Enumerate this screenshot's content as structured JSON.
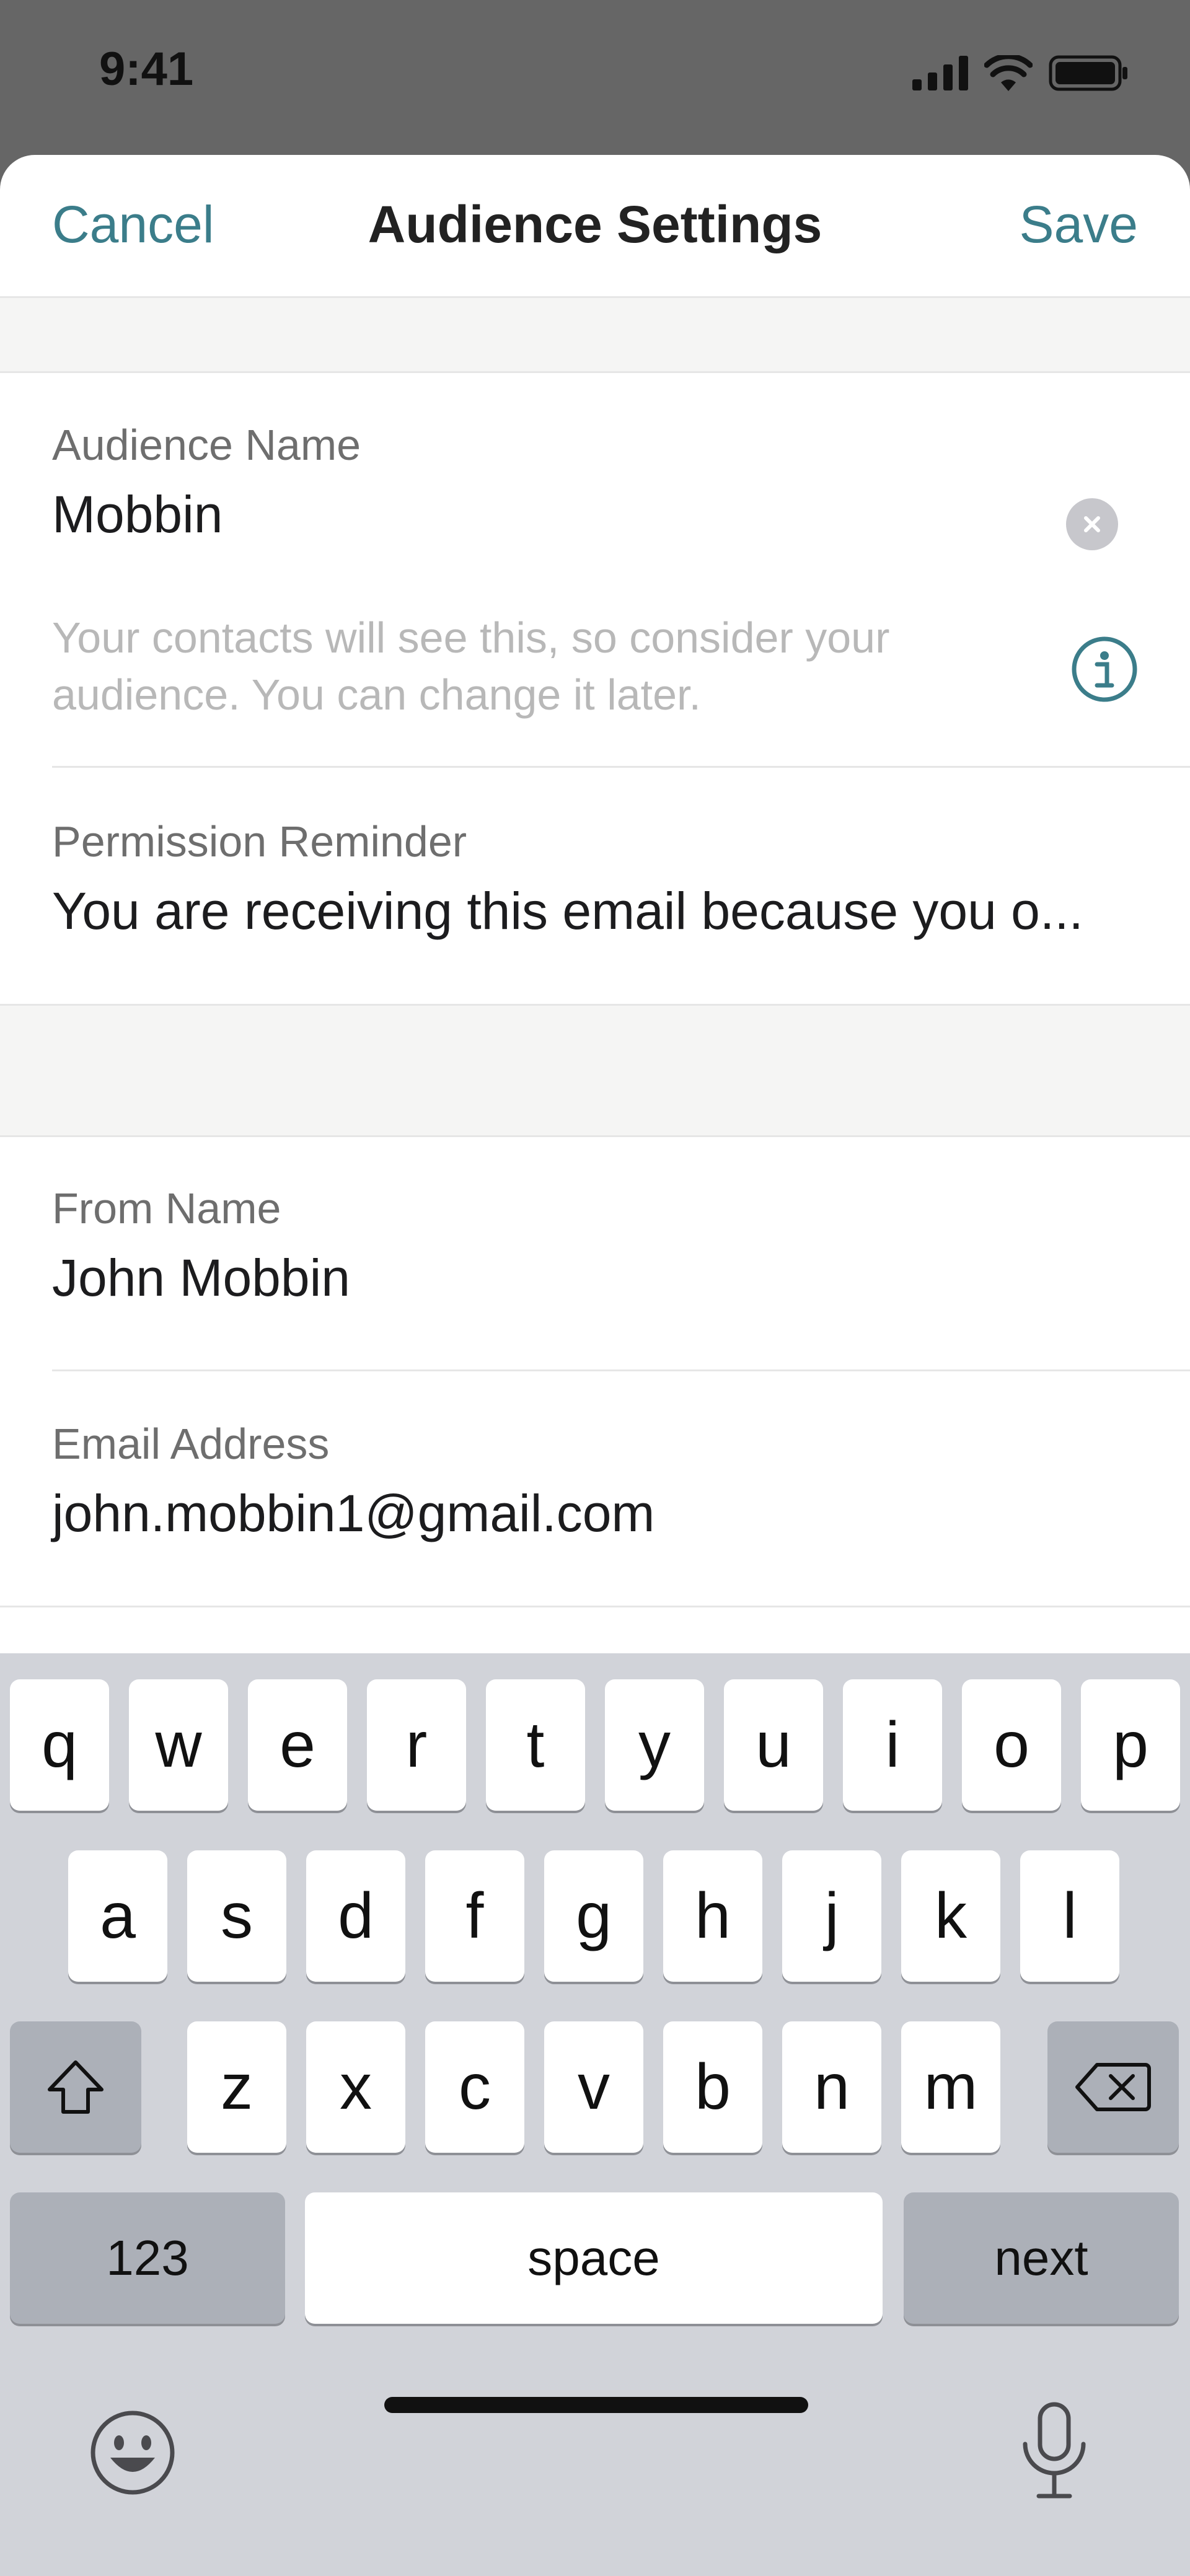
{
  "status_bar": {
    "time": "9:41",
    "icons": [
      "signal-icon",
      "wifi-icon",
      "battery-icon"
    ]
  },
  "nav": {
    "cancel_label": "Cancel",
    "title": "Audience Settings",
    "save_label": "Save"
  },
  "form": {
    "audience_name": {
      "label": "Audience Name",
      "value": "Mobbin",
      "helper": "Your contacts will see this, so consider your audience. You can change it later."
    },
    "permission_reminder": {
      "label": "Permission Reminder",
      "value": "You are receiving this email because you o..."
    },
    "from_name": {
      "label": "From Name",
      "value": "John Mobbin"
    },
    "email_address": {
      "label": "Email Address",
      "value": "john.mobbin1@gmail.com"
    }
  },
  "keyboard": {
    "row1": [
      "q",
      "w",
      "e",
      "r",
      "t",
      "y",
      "u",
      "i",
      "o",
      "p"
    ],
    "row2": [
      "a",
      "s",
      "d",
      "f",
      "g",
      "h",
      "j",
      "k",
      "l"
    ],
    "row3": [
      "z",
      "x",
      "c",
      "v",
      "b",
      "n",
      "m"
    ],
    "numbers_label": "123",
    "space_label": "space",
    "next_label": "next"
  },
  "colors": {
    "accent": "#3b7d8a",
    "status_background": "#666666",
    "keyboard_background": "#d1d3d9"
  }
}
